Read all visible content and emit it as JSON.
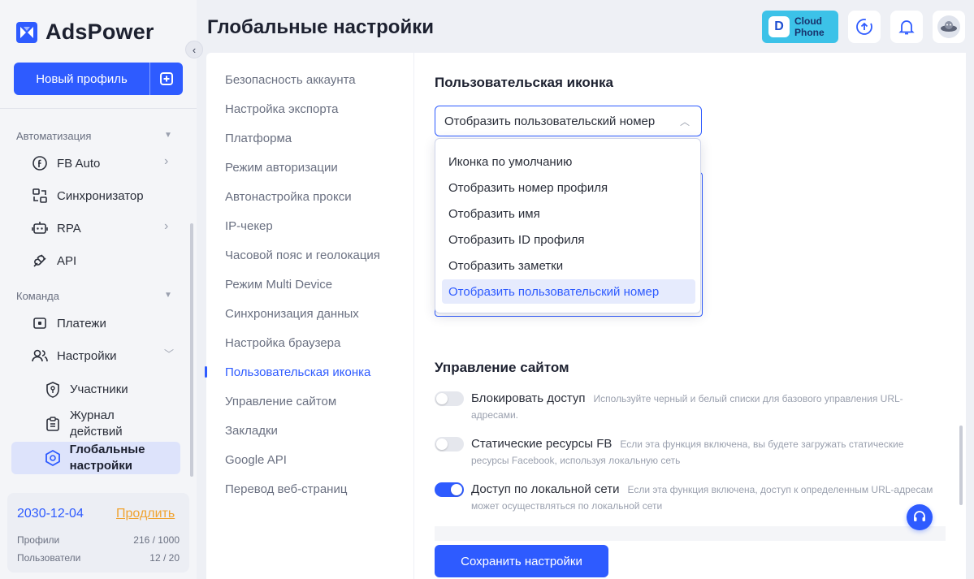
{
  "app": {
    "name": "AdsPower"
  },
  "sidebar": {
    "new_profile_label": "Новый профиль",
    "sections": {
      "automation": "Автоматизация",
      "team": "Команда"
    },
    "items": {
      "fb_auto": "FB Auto",
      "synchronizer": "Синхронизатор",
      "rpa": "RPA",
      "api": "API",
      "payments": "Платежи",
      "settings": "Настройки",
      "members": "Участники",
      "action_log": "Журнал действий",
      "global_settings": "Глобальные настройки"
    },
    "footer": {
      "date": "2030-12-04",
      "extend": "Продлить",
      "profiles_label": "Профили",
      "profiles_value": "216 / 1000",
      "users_label": "Пользователи",
      "users_value": "12 / 20"
    }
  },
  "header": {
    "title": "Глобальные настройки",
    "cloud_phone_line1": "Cloud",
    "cloud_phone_line2": "Phone"
  },
  "settings_menu": [
    "Безопасность аккаунта",
    "Настройка экспорта",
    "Платформа",
    "Режим авторизации",
    "Автонастройка прокси",
    "IP-чекер",
    "Часовой пояс и геолокация",
    "Режим Multi Device",
    "Синхронизация данных",
    "Настройка браузера",
    "Пользовательская иконка",
    "Управление сайтом",
    "Закладки",
    "Google API",
    "Перевод веб-страниц"
  ],
  "custom_icon": {
    "title": "Пользовательская иконка",
    "selected": "Отобразить пользовательский номер",
    "options": [
      "Иконка по умолчанию",
      "Отобразить номер профиля",
      "Отобразить имя",
      "Отобразить ID профиля",
      "Отобразить заметки",
      "Отобразить пользовательский номер"
    ]
  },
  "site_management": {
    "title": "Управление сайтом",
    "toggles": [
      {
        "label": "Блокировать доступ",
        "desc": "Используйте черный и белый списки для базового управления URL-адресами.",
        "on": false
      },
      {
        "label": "Статические ресурсы FB",
        "desc": "Если эта функция включена, вы будете загружать статические ресурсы Facebook, используя локальную сеть",
        "on": false
      },
      {
        "label": "Доступ по локальной сети",
        "desc": "Если эта функция включена, доступ к определенным URL-адресам может осуществляться по локальной сети",
        "on": true
      }
    ]
  },
  "save_label": "Сохранить настройки",
  "colors": {
    "accent": "#2e5bff",
    "extend": "#f0a331",
    "cloud_phone": "#3cc2e8"
  }
}
